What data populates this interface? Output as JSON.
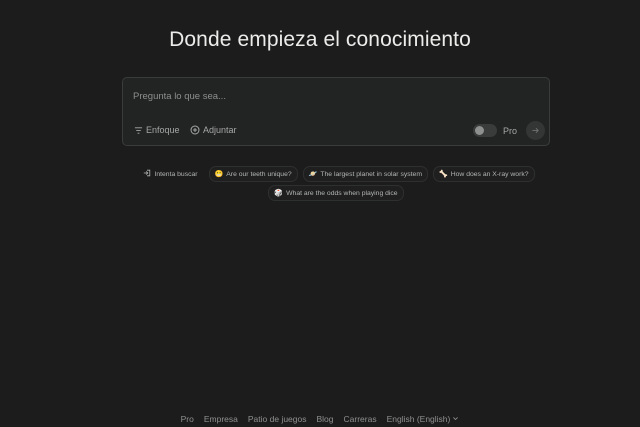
{
  "headline": "Donde empieza el conocimiento",
  "search": {
    "placeholder": "Pregunta lo que sea...",
    "focus_label": "Enfoque",
    "attach_label": "Adjuntar",
    "pro_label": "Pro",
    "pro_enabled": false
  },
  "suggestions": {
    "row1": [
      {
        "icon": "arrow-in-icon",
        "label": "Intenta buscar"
      },
      {
        "icon": "😬",
        "label": "Are our teeth unique?"
      },
      {
        "icon": "🪐",
        "label": "The largest planet in solar system"
      },
      {
        "icon": "🦴",
        "label": "How does an X-ray work?"
      }
    ],
    "row2": [
      {
        "icon": "🎲",
        "label": "What are the odds when playing dice"
      }
    ]
  },
  "footer": {
    "links": [
      "Pro",
      "Empresa",
      "Patio de juegos",
      "Blog",
      "Carreras"
    ],
    "language": "English (English)"
  },
  "colors": {
    "background": "#1c1c1c",
    "box": "#222323",
    "border": "#3a3b3b",
    "muted_text": "#8e908f"
  }
}
